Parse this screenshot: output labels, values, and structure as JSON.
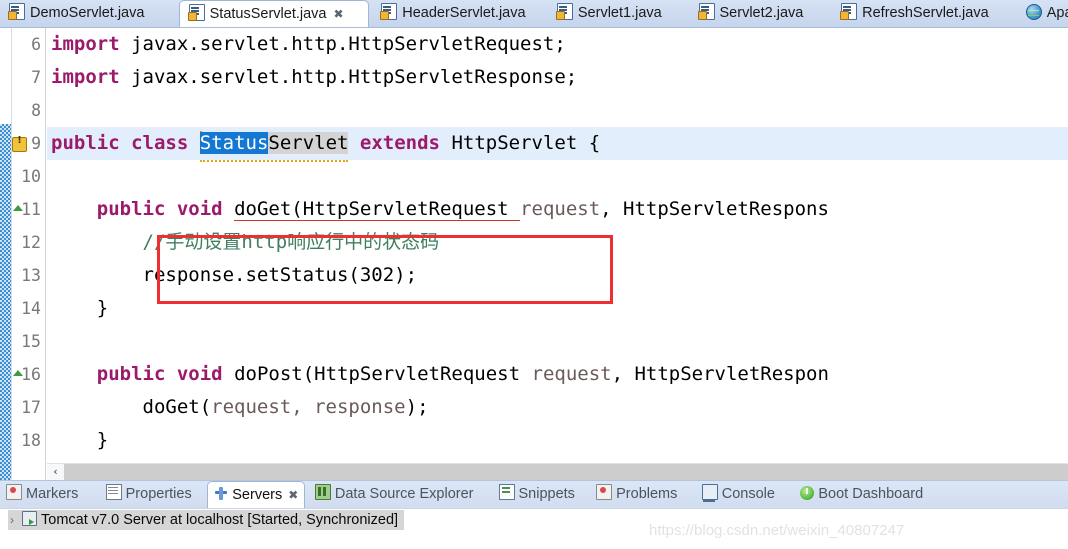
{
  "editor_tabs": [
    {
      "label": "DemoServlet.java",
      "icon": "java-file-icon",
      "active": false,
      "closable": false
    },
    {
      "label": "StatusServlet.java",
      "icon": "java-file-icon",
      "active": true,
      "closable": true
    },
    {
      "label": "HeaderServlet.java",
      "icon": "java-file-icon",
      "active": false,
      "closable": false
    },
    {
      "label": "Servlet1.java",
      "icon": "java-file-icon",
      "active": false,
      "closable": false
    },
    {
      "label": "Servlet2.java",
      "icon": "java-file-icon",
      "active": false,
      "closable": false
    },
    {
      "label": "RefreshServlet.java",
      "icon": "java-file-icon",
      "active": false,
      "closable": false
    },
    {
      "label": "Apa",
      "icon": "globe-icon",
      "active": false,
      "closable": false
    }
  ],
  "editor": {
    "close_glyph": "✖",
    "line_numbers": [
      "6",
      "7",
      "8",
      "9",
      "10",
      "11",
      "12",
      "13",
      "14",
      "15",
      "16",
      "17",
      "18"
    ],
    "lines": {
      "l6_kw": "import",
      "l6_rest": " javax.servlet.http.HttpServletRequest;",
      "l7_kw": "import",
      "l7_rest": " javax.servlet.http.HttpServletResponse;",
      "l9_public": "public",
      "l9_class": "class",
      "l9_sel": "Status",
      "l9_occ": "Servlet",
      "l9_extends": "extends",
      "l9_super": " HttpServlet {",
      "l11_public": "public",
      "l11_void": "void",
      "l11_sig": "doGet(HttpServletRequest ",
      "l11_req": "request",
      "l11_tail": ", HttpServletRespons",
      "l12_comment": "//手动设置http响应行中的状态码",
      "l13_code": "response.setStatus(302);",
      "l14_brace": "}",
      "l16_public": "public",
      "l16_void": "void",
      "l16_sig": "doPost(HttpServletRequest ",
      "l16_req": "request",
      "l16_tail": ", HttpServletRespon",
      "l17_call": "doGet(",
      "l17_args": "request, response",
      "l17_end": ");",
      "l18_brace": "}"
    },
    "scrollbar": {
      "left_arrow": "‹"
    },
    "colors": {
      "keyword": "#9b1a6a",
      "comment": "#3f7f5f",
      "selection": "#1478d2",
      "occurrence": "#d4d4d4",
      "current_line": "#e3eefc",
      "caret": "#ff8a00",
      "annotation_box": "#ef2f2f"
    }
  },
  "view_tabs": [
    {
      "label": "Markers",
      "icon": "markers-icon",
      "active": false,
      "closable": false
    },
    {
      "label": "Properties",
      "icon": "properties-icon",
      "active": false,
      "closable": false
    },
    {
      "label": "Servers",
      "icon": "servers-icon",
      "active": true,
      "closable": true
    },
    {
      "label": "Data Source Explorer",
      "icon": "data-source-icon",
      "active": false,
      "closable": false
    },
    {
      "label": "Snippets",
      "icon": "snippets-icon",
      "active": false,
      "closable": false
    },
    {
      "label": "Problems",
      "icon": "problems-icon",
      "active": false,
      "closable": false
    },
    {
      "label": "Console",
      "icon": "console-icon",
      "active": false,
      "closable": false
    },
    {
      "label": "Boot Dashboard",
      "icon": "boot-dashboard-icon",
      "active": false,
      "closable": false
    }
  ],
  "servers_panel": {
    "expander_glyph": "›",
    "row_label": "Tomcat v7.0 Server at localhost  [Started, Synchronized]"
  },
  "watermark": "https://blog.csdn.net/weixin_40807247"
}
